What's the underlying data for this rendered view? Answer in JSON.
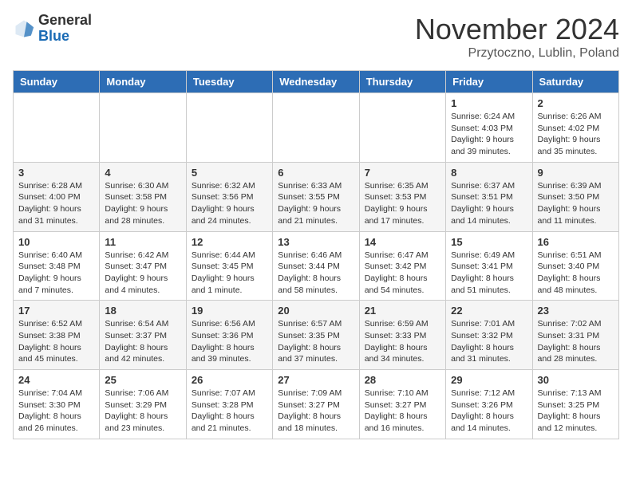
{
  "header": {
    "logo_line1": "General",
    "logo_line2": "Blue",
    "month": "November 2024",
    "location": "Przytoczno, Lublin, Poland"
  },
  "weekdays": [
    "Sunday",
    "Monday",
    "Tuesday",
    "Wednesday",
    "Thursday",
    "Friday",
    "Saturday"
  ],
  "weeks": [
    [
      {
        "day": "",
        "info": ""
      },
      {
        "day": "",
        "info": ""
      },
      {
        "day": "",
        "info": ""
      },
      {
        "day": "",
        "info": ""
      },
      {
        "day": "",
        "info": ""
      },
      {
        "day": "1",
        "info": "Sunrise: 6:24 AM\nSunset: 4:03 PM\nDaylight: 9 hours and 39 minutes."
      },
      {
        "day": "2",
        "info": "Sunrise: 6:26 AM\nSunset: 4:02 PM\nDaylight: 9 hours and 35 minutes."
      }
    ],
    [
      {
        "day": "3",
        "info": "Sunrise: 6:28 AM\nSunset: 4:00 PM\nDaylight: 9 hours and 31 minutes."
      },
      {
        "day": "4",
        "info": "Sunrise: 6:30 AM\nSunset: 3:58 PM\nDaylight: 9 hours and 28 minutes."
      },
      {
        "day": "5",
        "info": "Sunrise: 6:32 AM\nSunset: 3:56 PM\nDaylight: 9 hours and 24 minutes."
      },
      {
        "day": "6",
        "info": "Sunrise: 6:33 AM\nSunset: 3:55 PM\nDaylight: 9 hours and 21 minutes."
      },
      {
        "day": "7",
        "info": "Sunrise: 6:35 AM\nSunset: 3:53 PM\nDaylight: 9 hours and 17 minutes."
      },
      {
        "day": "8",
        "info": "Sunrise: 6:37 AM\nSunset: 3:51 PM\nDaylight: 9 hours and 14 minutes."
      },
      {
        "day": "9",
        "info": "Sunrise: 6:39 AM\nSunset: 3:50 PM\nDaylight: 9 hours and 11 minutes."
      }
    ],
    [
      {
        "day": "10",
        "info": "Sunrise: 6:40 AM\nSunset: 3:48 PM\nDaylight: 9 hours and 7 minutes."
      },
      {
        "day": "11",
        "info": "Sunrise: 6:42 AM\nSunset: 3:47 PM\nDaylight: 9 hours and 4 minutes."
      },
      {
        "day": "12",
        "info": "Sunrise: 6:44 AM\nSunset: 3:45 PM\nDaylight: 9 hours and 1 minute."
      },
      {
        "day": "13",
        "info": "Sunrise: 6:46 AM\nSunset: 3:44 PM\nDaylight: 8 hours and 58 minutes."
      },
      {
        "day": "14",
        "info": "Sunrise: 6:47 AM\nSunset: 3:42 PM\nDaylight: 8 hours and 54 minutes."
      },
      {
        "day": "15",
        "info": "Sunrise: 6:49 AM\nSunset: 3:41 PM\nDaylight: 8 hours and 51 minutes."
      },
      {
        "day": "16",
        "info": "Sunrise: 6:51 AM\nSunset: 3:40 PM\nDaylight: 8 hours and 48 minutes."
      }
    ],
    [
      {
        "day": "17",
        "info": "Sunrise: 6:52 AM\nSunset: 3:38 PM\nDaylight: 8 hours and 45 minutes."
      },
      {
        "day": "18",
        "info": "Sunrise: 6:54 AM\nSunset: 3:37 PM\nDaylight: 8 hours and 42 minutes."
      },
      {
        "day": "19",
        "info": "Sunrise: 6:56 AM\nSunset: 3:36 PM\nDaylight: 8 hours and 39 minutes."
      },
      {
        "day": "20",
        "info": "Sunrise: 6:57 AM\nSunset: 3:35 PM\nDaylight: 8 hours and 37 minutes."
      },
      {
        "day": "21",
        "info": "Sunrise: 6:59 AM\nSunset: 3:33 PM\nDaylight: 8 hours and 34 minutes."
      },
      {
        "day": "22",
        "info": "Sunrise: 7:01 AM\nSunset: 3:32 PM\nDaylight: 8 hours and 31 minutes."
      },
      {
        "day": "23",
        "info": "Sunrise: 7:02 AM\nSunset: 3:31 PM\nDaylight: 8 hours and 28 minutes."
      }
    ],
    [
      {
        "day": "24",
        "info": "Sunrise: 7:04 AM\nSunset: 3:30 PM\nDaylight: 8 hours and 26 minutes."
      },
      {
        "day": "25",
        "info": "Sunrise: 7:06 AM\nSunset: 3:29 PM\nDaylight: 8 hours and 23 minutes."
      },
      {
        "day": "26",
        "info": "Sunrise: 7:07 AM\nSunset: 3:28 PM\nDaylight: 8 hours and 21 minutes."
      },
      {
        "day": "27",
        "info": "Sunrise: 7:09 AM\nSunset: 3:27 PM\nDaylight: 8 hours and 18 minutes."
      },
      {
        "day": "28",
        "info": "Sunrise: 7:10 AM\nSunset: 3:27 PM\nDaylight: 8 hours and 16 minutes."
      },
      {
        "day": "29",
        "info": "Sunrise: 7:12 AM\nSunset: 3:26 PM\nDaylight: 8 hours and 14 minutes."
      },
      {
        "day": "30",
        "info": "Sunrise: 7:13 AM\nSunset: 3:25 PM\nDaylight: 8 hours and 12 minutes."
      }
    ]
  ]
}
